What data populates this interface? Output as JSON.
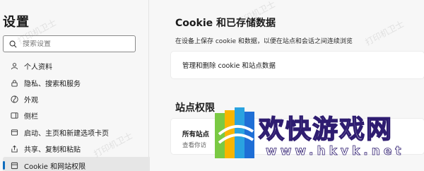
{
  "sidebar": {
    "title": "设置",
    "search": {
      "placeholder": "搜索设置",
      "value": ""
    },
    "items": [
      {
        "label": "个人资料",
        "icon": "profile-icon",
        "active": false
      },
      {
        "label": "隐私、搜索和服务",
        "icon": "lock-icon",
        "active": false
      },
      {
        "label": "外观",
        "icon": "appearance-icon",
        "active": false
      },
      {
        "label": "侧栏",
        "icon": "sidebar-icon",
        "active": false
      },
      {
        "label": "启动、主页和新建选项卡页",
        "icon": "home-icon",
        "active": false
      },
      {
        "label": "共享、复制和粘贴",
        "icon": "share-icon",
        "active": false
      },
      {
        "label": "Cookie 和网站权限",
        "icon": "cookie-site-icon",
        "active": true
      }
    ]
  },
  "main": {
    "section_title": "Cookie 和已存储数据",
    "section_desc": "在设备上保存 cookie 和数据，以便在站点和会话之间连续浏览",
    "manage_card_label": "管理和删除 cookie 和站点数据",
    "section2_title": "站点权限",
    "all_sites_title": "所有站点",
    "all_sites_desc": "查看你访"
  },
  "watermark": {
    "text": "打印机卫士"
  },
  "overlay": {
    "logo_text": "欢快游戏网",
    "logo_url": "www.hkvk.net"
  },
  "colors": {
    "accent": "#0f6cbd",
    "sidebar_bg": "#f7f7f7",
    "card_bg": "#ffffff"
  }
}
